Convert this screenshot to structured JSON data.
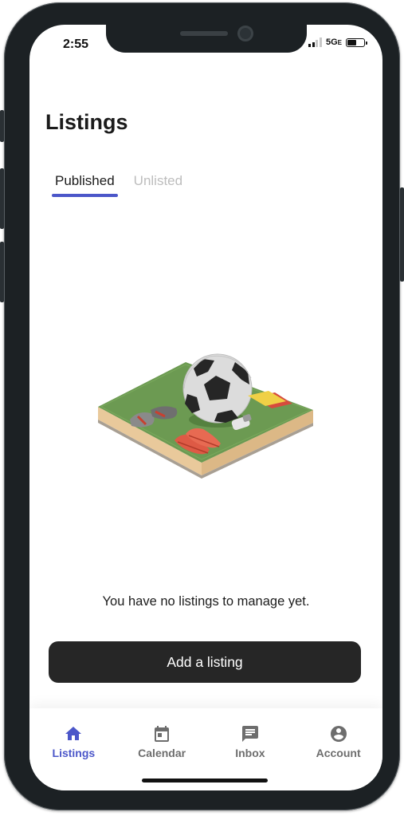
{
  "status_bar": {
    "time": "2:55",
    "network": "5G",
    "network_suffix": "E"
  },
  "header": {
    "title": "Listings"
  },
  "tabs": [
    {
      "label": "Published",
      "active": true
    },
    {
      "label": "Unlisted",
      "active": false
    }
  ],
  "empty_state": {
    "illustration": "soccer-field-illustration",
    "message": "You have no listings to manage yet."
  },
  "actions": {
    "add_listing_label": "Add a listing"
  },
  "bottom_nav": [
    {
      "label": "Listings",
      "icon": "home-icon",
      "active": true
    },
    {
      "label": "Calendar",
      "icon": "calendar-icon",
      "active": false
    },
    {
      "label": "Inbox",
      "icon": "inbox-icon",
      "active": false
    },
    {
      "label": "Account",
      "icon": "account-icon",
      "active": false
    }
  ],
  "colors": {
    "accent": "#4b56c9",
    "button_bg": "#262626",
    "inactive_nav": "#6d6d6d",
    "inactive_tab": "#bdbdbd"
  }
}
